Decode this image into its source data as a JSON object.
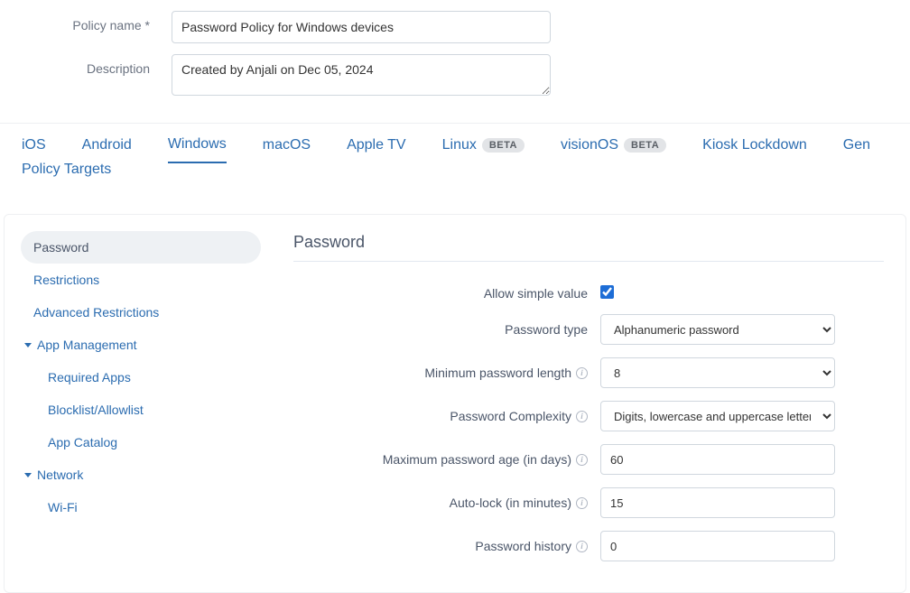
{
  "form": {
    "policy_name_label": "Policy name",
    "policy_name_value": "Password Policy for Windows devices",
    "description_label": "Description",
    "description_value": "Created by Anjali on Dec 05, 2024"
  },
  "tabs": {
    "ios": "iOS",
    "android": "Android",
    "windows": "Windows",
    "macos": "macOS",
    "appletv": "Apple TV",
    "linux": "Linux",
    "visionos": "visionOS",
    "kiosk": "Kiosk Lockdown",
    "gen": "Gen",
    "policy_targets": "Policy Targets",
    "beta": "BETA"
  },
  "sidebar": {
    "password": "Password",
    "restrictions": "Restrictions",
    "adv_restrictions": "Advanced Restrictions",
    "app_mgmt": "App Management",
    "required_apps": "Required Apps",
    "blocklist": "Blocklist/Allowlist",
    "app_catalog": "App Catalog",
    "network": "Network",
    "wifi": "Wi-Fi"
  },
  "panel": {
    "title": "Password",
    "allow_simple": {
      "label": "Allow simple value",
      "checked": true
    },
    "password_type": {
      "label": "Password type",
      "value": "Alphanumeric password"
    },
    "min_length": {
      "label": "Minimum password length",
      "value": "8"
    },
    "complexity": {
      "label": "Password Complexity",
      "value": "Digits, lowercase and uppercase letters"
    },
    "max_age": {
      "label": "Maximum password age (in days)",
      "value": "60"
    },
    "auto_lock": {
      "label": "Auto-lock (in minutes)",
      "value": "15"
    },
    "history": {
      "label": "Password history",
      "value": "0"
    }
  }
}
